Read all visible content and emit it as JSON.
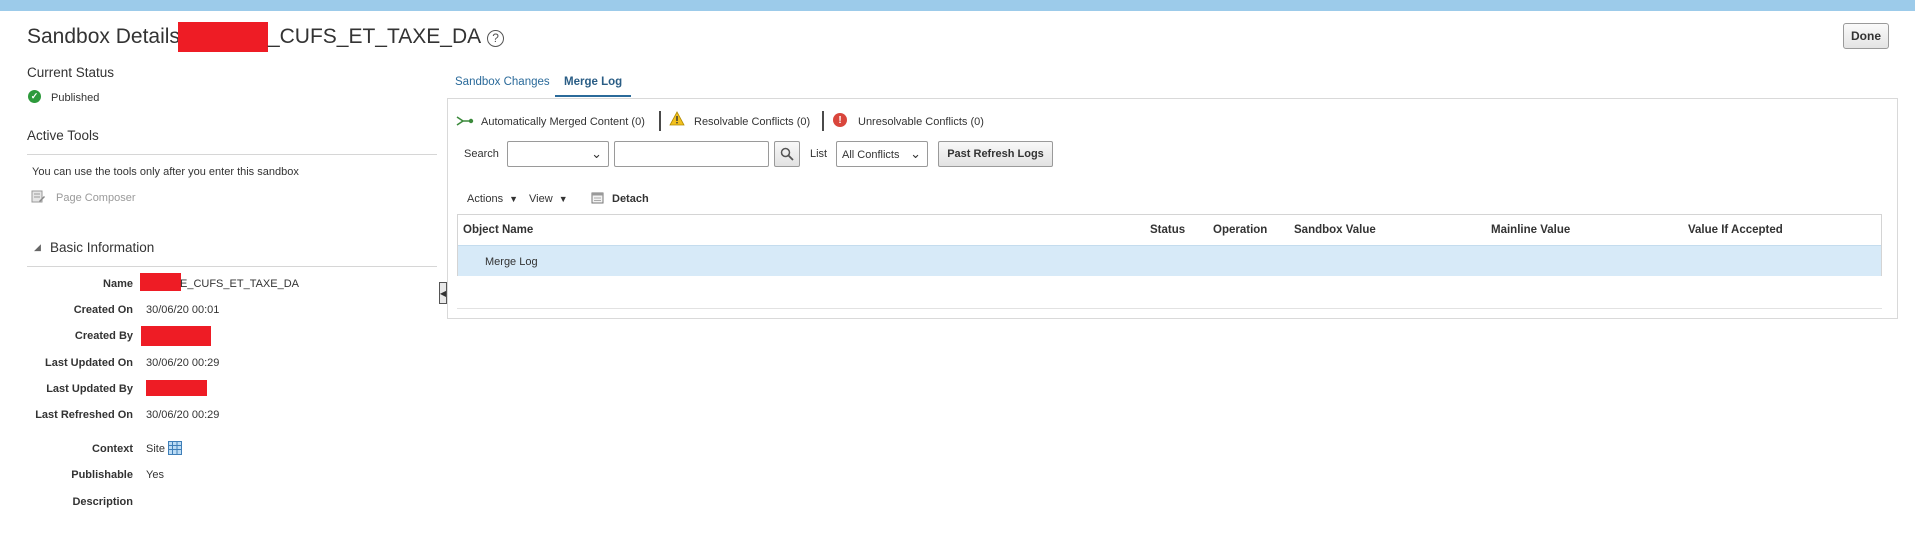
{
  "header": {
    "title_prefix": "Sandbox Details",
    "title_suffix": "_CUFS_ET_TAXE_DA",
    "help_icon": "question-circle-icon",
    "done_label": "Done"
  },
  "left": {
    "current_status_heading": "Current Status",
    "status_value": "Published",
    "status_color": "#2e9a3c",
    "active_tools_heading": "Active Tools",
    "tools_note": "You can use the tools only after you enter this sandbox",
    "page_composer_label": "Page Composer",
    "basic_info_heading": "Basic Information",
    "fields": [
      {
        "label": "Name",
        "value": "E_CUFS_ET_TAXE_DA"
      },
      {
        "label": "Created On",
        "value": "30/06/20 00:01"
      },
      {
        "label": "Created By",
        "value": ""
      },
      {
        "label": "Last Updated On",
        "value": "30/06/20 00:29"
      },
      {
        "label": "Last Updated By",
        "value": ""
      },
      {
        "label": "Last Refreshed On",
        "value": "30/06/20 00:29"
      },
      {
        "label": "Context",
        "value": "Site"
      },
      {
        "label": "Publishable",
        "value": "Yes"
      },
      {
        "label": "Description",
        "value": ""
      }
    ]
  },
  "tabs": [
    {
      "label": "Sandbox Changes",
      "active": false
    },
    {
      "label": "Merge Log",
      "active": true
    }
  ],
  "legend": {
    "auto_merged": "Automatically Merged Content (0)",
    "resolvable": "Resolvable Conflicts (0)",
    "unresolvable": "Unresolvable Conflicts (0)"
  },
  "search": {
    "label": "Search",
    "select_value": "",
    "input_value": "",
    "list_label": "List",
    "list_value": "All Conflicts",
    "past_refresh_label": "Past Refresh Logs"
  },
  "toolbar": {
    "actions_label": "Actions",
    "view_label": "View",
    "detach_label": "Detach"
  },
  "table": {
    "columns": [
      "Object Name",
      "Status",
      "Operation",
      "Sandbox Value",
      "Mainline Value",
      "Value If Accepted"
    ],
    "rows": [
      {
        "object_name": "Merge Log"
      }
    ]
  },
  "colors": {
    "accent_tab": "#2a6a9a",
    "selected_row": "#d7eaf8",
    "redaction": "#ee1c25",
    "top_bar": "#9ccbea"
  }
}
